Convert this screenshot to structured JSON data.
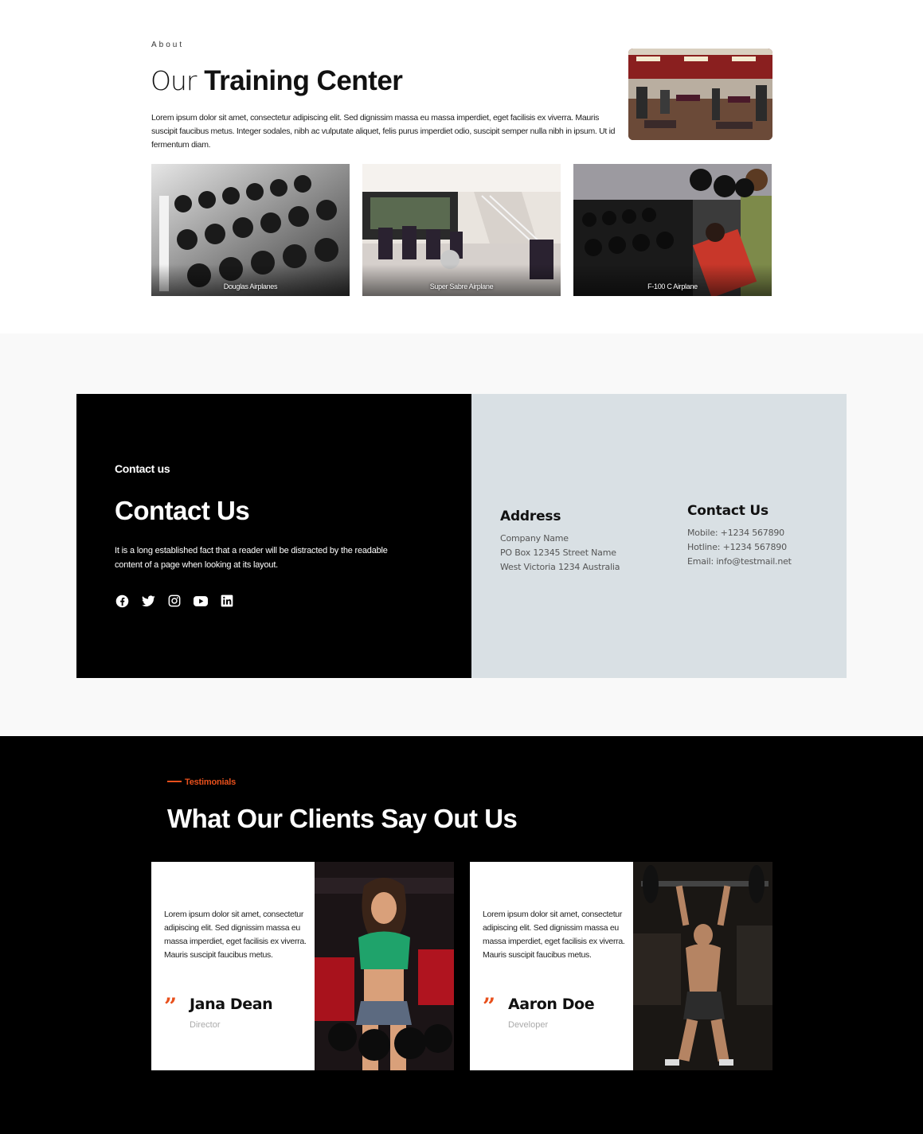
{
  "about": {
    "eyebrow": "About",
    "title_light": "Our",
    "title_bold": "Training Center",
    "text": "Lorem ipsum dolor sit amet, consectetur adipiscing elit. Sed dignissim massa eu massa imperdiet, eget facilisis ex viverra. Mauris suscipit faucibus metus. Integer sodales, nibh ac vulputate aliquet, felis purus imperdiet odio, suscipit semper nulla nibh in ipsum. Ut id fermentum diam.",
    "gallery": [
      {
        "caption": "Douglas Airplanes"
      },
      {
        "caption": "Super Sabre Airplane"
      },
      {
        "caption": "F-100 C Airplane"
      }
    ]
  },
  "contact": {
    "eyebrow": "Contact us",
    "title": "Contact Us",
    "text": "It is a long established fact that a reader will be distracted by the readable content of a page when looking at its layout.",
    "socials": [
      "facebook-icon",
      "twitter-icon",
      "instagram-icon",
      "youtube-icon",
      "linkedin-icon"
    ],
    "address": {
      "heading": "Address",
      "lines": [
        "Company Name",
        "PO Box 12345 Street Name",
        "West Victoria 1234 Australia"
      ]
    },
    "info": {
      "heading": "Contact Us",
      "lines": [
        "Mobile: +1234 567890",
        "Hotline: +1234 567890",
        "Email: info@testmail.net"
      ]
    }
  },
  "testimonials": {
    "eyebrow": "Testimonials",
    "title": "What Our Clients Say Out Us",
    "accent": "#e8501c",
    "items": [
      {
        "text": "Lorem ipsum dolor sit amet, consectetur adipiscing elit. Sed dignissim massa eu massa imperdiet, eget facilisis ex viverra. Mauris suscipit faucibus metus.",
        "name": "Jana Dean",
        "role": "Director"
      },
      {
        "text": "Lorem ipsum dolor sit amet, consectetur adipiscing elit. Sed dignissim massa eu massa imperdiet, eget facilisis ex viverra. Mauris suscipit faucibus metus.",
        "name": "Aaron Doe",
        "role": "Developer"
      }
    ]
  }
}
